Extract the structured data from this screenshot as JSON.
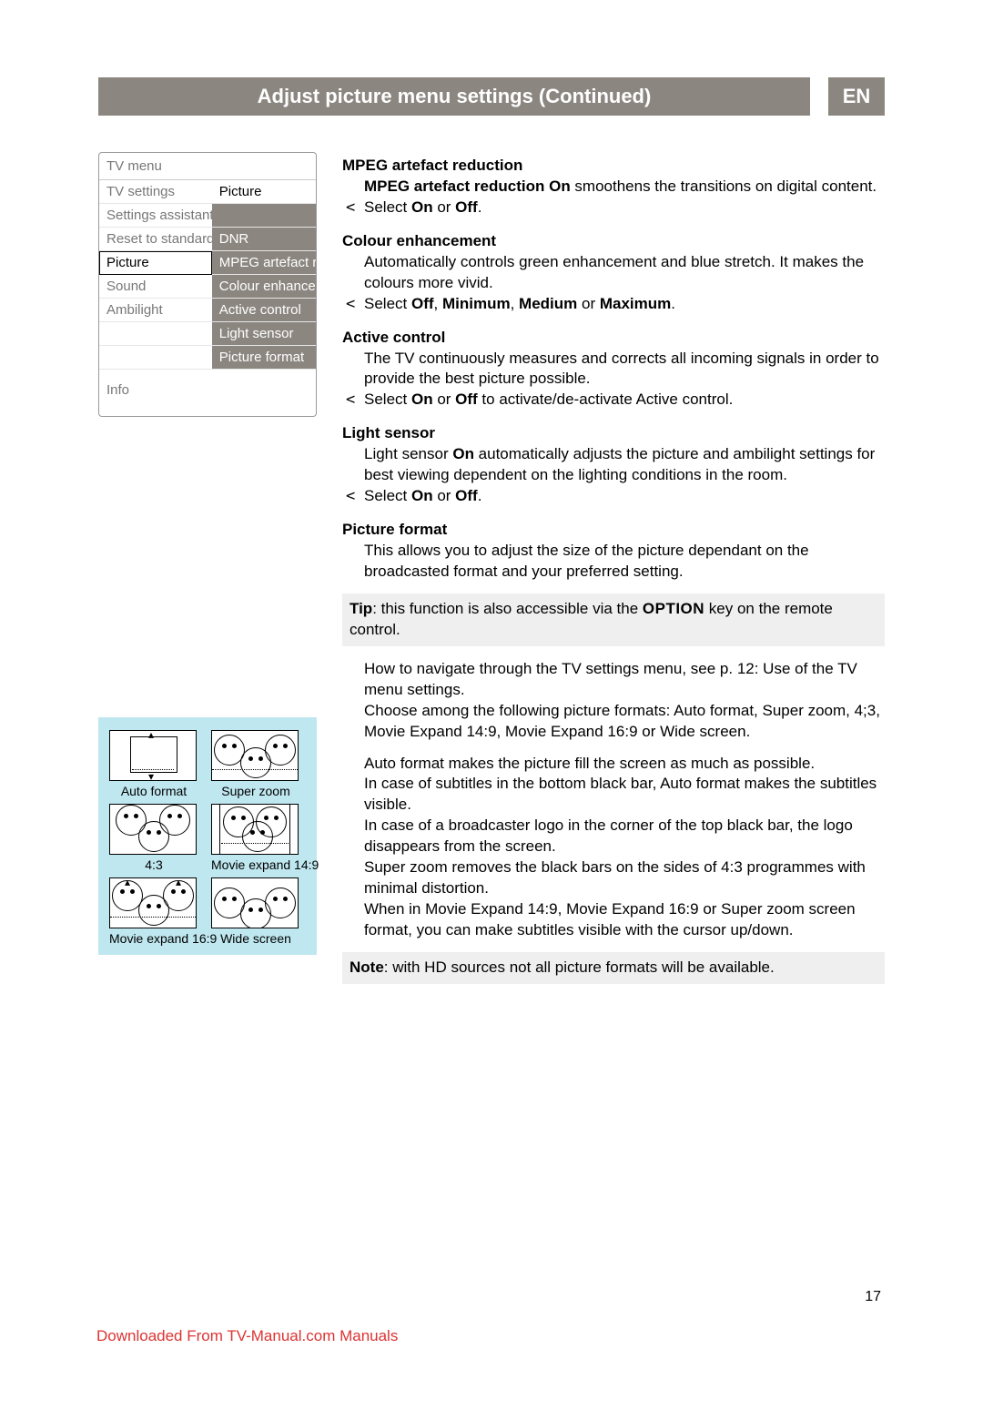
{
  "header": {
    "title": "Adjust picture menu settings  (Continued)",
    "lang": "EN"
  },
  "tv_menu": {
    "title": "TV menu",
    "colA_header": "TV settings",
    "colB_header": "Picture",
    "colA_items": [
      "Settings assistant",
      "Reset to standard",
      "Picture",
      "Sound",
      "Ambilight"
    ],
    "colB_items": [
      "............",
      "DNR",
      "MPEG artefact red.",
      "Colour enhancem..",
      "Active control",
      "Light sensor",
      "Picture format"
    ],
    "selected_A_index": 2,
    "info_label": "Info"
  },
  "formats": {
    "row1": [
      "Auto format",
      "Super zoom"
    ],
    "row2": [
      "4:3",
      "Movie expand 14:9"
    ],
    "row3": [
      "Movie expand 16:9",
      "Wide screen"
    ]
  },
  "sections": {
    "mpeg": {
      "title": "MPEG artefact reduction",
      "body_pre": "MPEG artefact reduction On",
      "body_post": " smoothens the transitions on digital content.",
      "bullet": "Select ",
      "b_on": "On",
      "b_or": " or ",
      "b_off": "Off",
      "b_end": "."
    },
    "colour": {
      "title": "Colour enhancement",
      "body": "Automatically controls green enhancement and blue stretch. It makes the colours more vivid.",
      "bullet": "Select ",
      "opts": [
        "Off",
        "Minimum",
        "Medium",
        "Maximum"
      ]
    },
    "active": {
      "title": "Active control",
      "body": "The TV continuously measures and corrects all incoming signals in order to provide the best picture possible.",
      "bullet_pre": "Select ",
      "b_on": "On",
      "b_or": " or ",
      "b_off": "Off",
      "bullet_post": " to activate/de-activate Active control."
    },
    "light": {
      "title": "Light sensor",
      "body_pre": "Light sensor ",
      "body_bold": "On",
      "body_post": " automatically adjusts the picture and ambilight settings for best viewing dependent on the lighting conditions in the room.",
      "bullet": "Select ",
      "b_on": "On",
      "b_or": " or ",
      "b_off": "Off",
      "b_end": "."
    },
    "pformat": {
      "title": "Picture format",
      "intro": "This allows you to adjust the size of the picture dependant on the broadcasted format and your preferred setting.",
      "tip_label": "Tip",
      "tip_text": ": this function is also accessible via the ",
      "tip_key": "OPTION",
      "tip_post": " key on the remote control.",
      "nav": "How to navigate through the TV settings menu, see p. 12: Use of the TV menu settings.",
      "choose": "Choose among the following picture formats: Auto format, Super zoom, 4;3, Movie Expand 14:9, Movie Expand 16:9 or Wide screen.",
      "auto1": "Auto format makes the picture fill the screen as much as possible.",
      "auto2": "In case of subtitles in the bottom black bar, Auto format makes the subtitles visible.",
      "auto3": "In case of a broadcaster logo in the corner of the top black bar, the logo disappears from the screen.",
      "super": "Super zoom removes the black bars on the sides of 4:3 programmes with minimal distortion.",
      "movie": "When in Movie Expand 14:9, Movie Expand 16:9 or Super zoom screen format, you can make subtitles visible with the cursor up/down.",
      "note_label": "Note",
      "note_text": ": with HD sources not all picture formats will be available."
    }
  },
  "page_number": "17",
  "footer": "Downloaded From TV-Manual.com Manuals"
}
